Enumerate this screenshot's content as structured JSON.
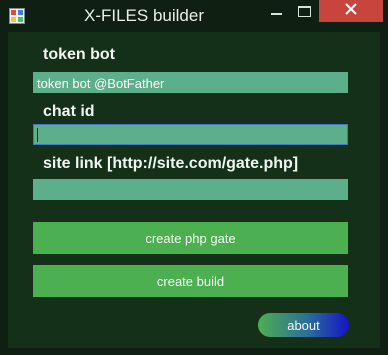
{
  "window": {
    "title": "X-FILES builder",
    "icon": "app-window-icon",
    "controls": {
      "minimize_icon": "minimize-icon",
      "maximize_icon": "maximize-icon",
      "close_icon": "close-icon"
    }
  },
  "form": {
    "token_bot": {
      "label": "token bot",
      "value": "token bot @BotFather"
    },
    "chat_id": {
      "label": "chat id",
      "value": ""
    },
    "site_link": {
      "label": "site link [http://site.com/gate.php]",
      "value": ""
    }
  },
  "buttons": {
    "create_php_gate": "create php gate",
    "create_build": "create build",
    "about": "about"
  },
  "colors": {
    "background": "#143018",
    "field": "#5caf8a",
    "button": "#4caf50",
    "close_button": "#c8453d",
    "focus_border": "#3f78c8"
  }
}
